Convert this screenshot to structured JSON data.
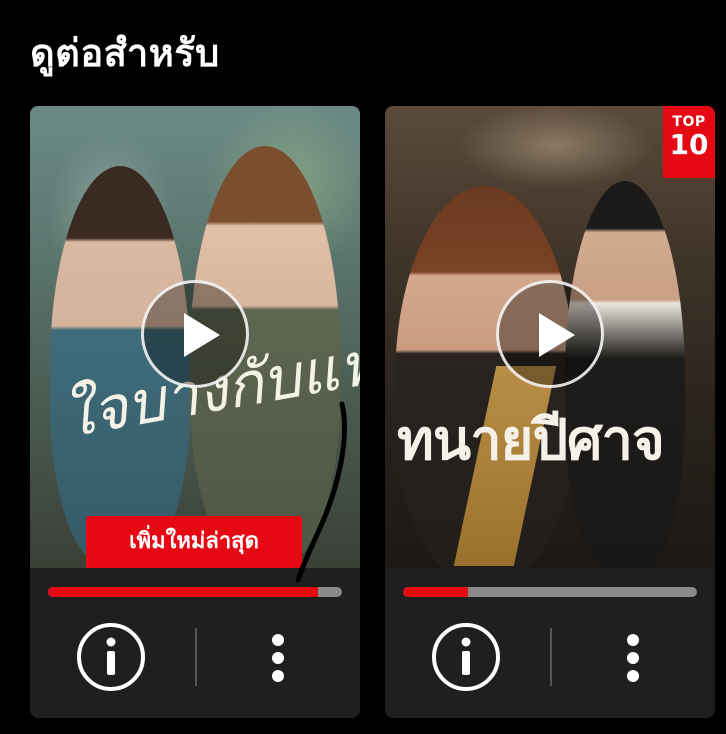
{
  "section": {
    "title": "ดูต่อสำหรับ"
  },
  "cards": [
    {
      "poster_title": "ใจบางกับแฟนเธอ",
      "badge": "เพิ่มใหม่ล่าสุด",
      "progress_percent": 92
    },
    {
      "poster_title": "ทนายปีศาจ",
      "top10_label_top": "TOP",
      "top10_label_num": "10",
      "progress_percent": 22
    }
  ],
  "colors": {
    "accent": "#e50914",
    "card_bg": "#1f1f1f",
    "track": "#8a8a8a"
  },
  "icons": {
    "play": "play-icon",
    "info": "info-icon",
    "more": "more-vertical-icon"
  }
}
